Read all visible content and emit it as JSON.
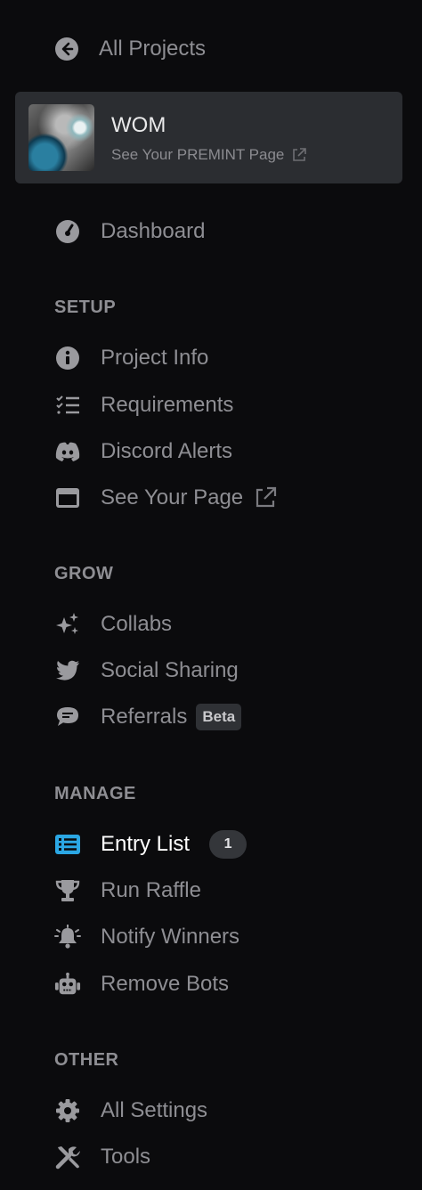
{
  "nav": {
    "back_label": "All Projects",
    "project": {
      "name": "WOM",
      "link_label": "See Your PREMINT Page"
    },
    "dashboard": {
      "label": "Dashboard",
      "icon": "gauge-icon"
    }
  },
  "sections": {
    "setup": {
      "title": "SETUP",
      "items": [
        {
          "label": "Project Info",
          "icon": "info-icon"
        },
        {
          "label": "Requirements",
          "icon": "checklist-icon"
        },
        {
          "label": "Discord Alerts",
          "icon": "discord-icon"
        },
        {
          "label": "See Your Page",
          "icon": "window-icon"
        }
      ]
    },
    "grow": {
      "title": "GROW",
      "items": [
        {
          "label": "Collabs",
          "icon": "sparkles-icon"
        },
        {
          "label": "Social Sharing",
          "icon": "twitter-icon"
        },
        {
          "label": "Referrals",
          "icon": "chat-icon",
          "badge": "Beta"
        }
      ]
    },
    "manage": {
      "title": "MANAGE",
      "items": [
        {
          "label": "Entry List",
          "icon": "list-icon",
          "count": "1",
          "active": true
        },
        {
          "label": "Run Raffle",
          "icon": "trophy-icon"
        },
        {
          "label": "Notify Winners",
          "icon": "bell-icon"
        },
        {
          "label": "Remove Bots",
          "icon": "robot-icon"
        }
      ]
    },
    "other": {
      "title": "OTHER",
      "items": [
        {
          "label": "All Settings",
          "icon": "gear-icon"
        },
        {
          "label": "Tools",
          "icon": "tools-icon"
        }
      ]
    }
  },
  "colors": {
    "background": "#0b0b0d",
    "card": "#2b2d31",
    "active_accent": "#2ba7e4",
    "active_text": "#ffffff",
    "muted_text": "#8e8e93"
  }
}
